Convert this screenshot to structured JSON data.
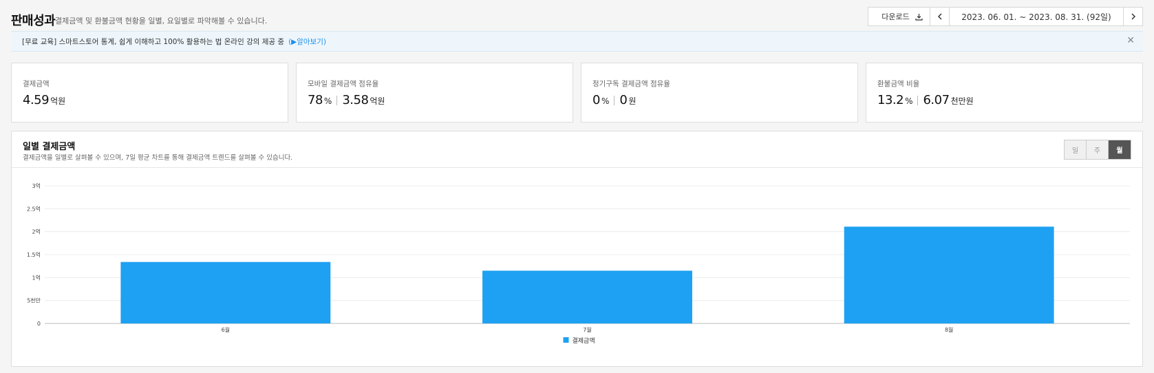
{
  "header": {
    "title": "판매성과",
    "description": "결제금액 및 환불금액 현황을 일별, 요일별로 파악해볼 수 있습니다.",
    "download_label": "다운로드",
    "date_range": "2023. 06. 01. ~ 2023. 08. 31. (92일)"
  },
  "banner": {
    "text": "[무료 교육] 스마트스토어 통계, 쉽게 이해하고 100% 활용하는 법 온라인 강의 제공 중",
    "link_text": "(▶알아보기)"
  },
  "kpis": [
    {
      "label": "결제금액",
      "values": [
        {
          "num": "4.59",
          "unit": "억원"
        }
      ]
    },
    {
      "label": "모바일 결제금액 점유율",
      "values": [
        {
          "num": "78",
          "unit": "%"
        },
        {
          "num": "3.58",
          "unit": "억원"
        }
      ]
    },
    {
      "label": "정기구독 결제금액 점유율",
      "values": [
        {
          "num": "0",
          "unit": "%"
        },
        {
          "num": "0",
          "unit": "원"
        }
      ]
    },
    {
      "label": "환불금액 비율",
      "values": [
        {
          "num": "13.2",
          "unit": "%"
        },
        {
          "num": "6.07",
          "unit": "천만원"
        }
      ]
    }
  ],
  "chart_section": {
    "title": "일별 결제금액",
    "description": "결제금액을 일별로 살펴볼 수 있으며, 7일 평균 차트를 통해 결제금액 트렌드를 살펴볼 수 있습니다.",
    "period_options": [
      "일",
      "주",
      "월"
    ],
    "selected_period": "월"
  },
  "chart_data": {
    "type": "bar",
    "categories": [
      "6월",
      "7월",
      "8월"
    ],
    "series": [
      {
        "name": "결제금액",
        "values": [
          134000000,
          115000000,
          211000000
        ],
        "color": "#1ea1f2"
      }
    ],
    "ylim": [
      0,
      300000000
    ],
    "yticks": [
      0,
      50000000,
      100000000,
      150000000,
      200000000,
      250000000,
      300000000
    ],
    "ytick_labels": [
      "0",
      "5천만",
      "1억",
      "1.5억",
      "2억",
      "2.5억",
      "3억"
    ],
    "grid": true,
    "legend": "bottom-center"
  },
  "icons": {
    "download": "download-icon",
    "prev": "chevron-left-icon",
    "next": "chevron-right-icon",
    "close": "close-icon"
  }
}
